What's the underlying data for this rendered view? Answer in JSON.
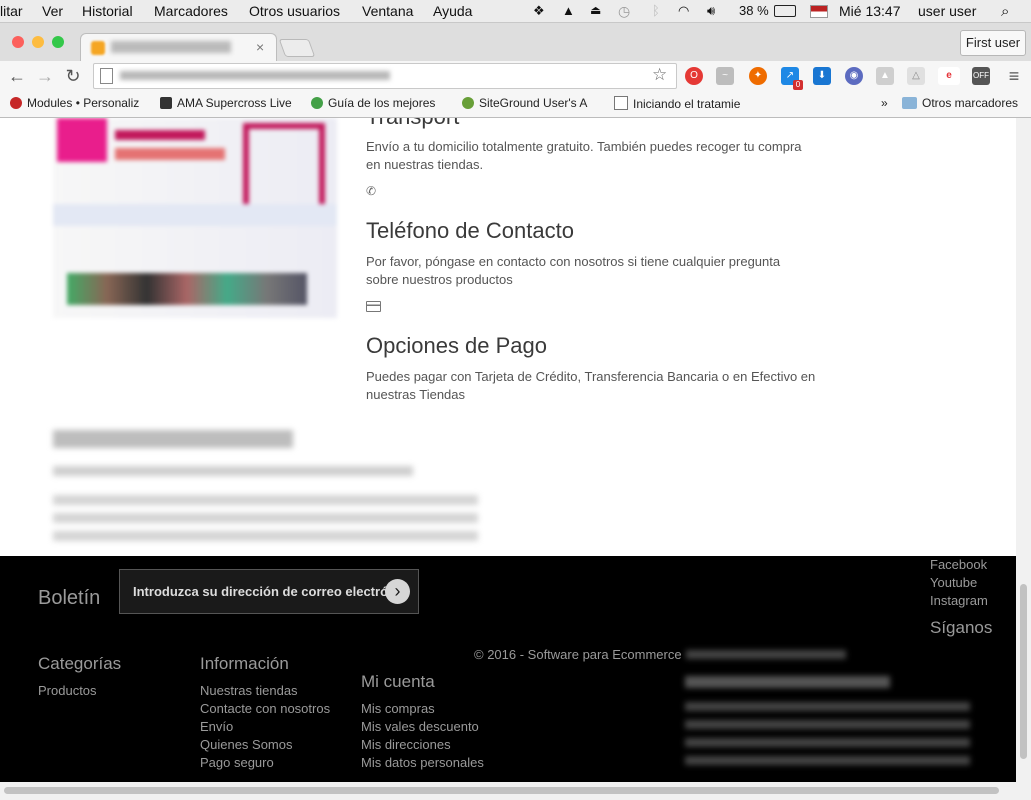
{
  "menubar": {
    "items": [
      "litar",
      "Ver",
      "Historial",
      "Marcadores",
      "Otros usuarios",
      "Ventana",
      "Ayuda"
    ],
    "battery": "38 %",
    "clock": "Mié 13:47",
    "user": "user user"
  },
  "browser": {
    "profile_button": "First user",
    "bookmarks": [
      {
        "label": "Modules • Personaliz",
        "icon": "bookmark-favicon"
      },
      {
        "label": "AMA Supercross Live",
        "icon": "bookmark-favicon"
      },
      {
        "label": "Guía de los mejores",
        "icon": "bookmark-favicon"
      },
      {
        "label": "SiteGround User's A",
        "icon": "bookmark-favicon"
      },
      {
        "label": "Iniciando el tratamie",
        "icon": "document-icon"
      }
    ],
    "bookmarks_overflow": "»",
    "other_bookmarks": "Otros marcadores",
    "extension_badge": "0"
  },
  "content": {
    "sections": [
      {
        "title": "Transport",
        "text": "Envío a tu domicilio totalmente gratuito. También puedes recoger tu compra en nuestras tiendas.",
        "icon": "phone-icon"
      },
      {
        "title": "Teléfono de Contacto",
        "text": "Por favor, póngase en contacto con nosotros si tiene cualquier pregunta sobre nuestros productos",
        "icon": "credit-card-icon"
      },
      {
        "title": "Opciones de Pago",
        "text": "Puedes pagar con Tarjeta de Crédito, Transferencia Bancaria o en Efectivo en nuestras Tiendas"
      }
    ]
  },
  "footer": {
    "newsletter_label": "Boletín",
    "newsletter_placeholder": "Introduzca su dirección de correo electrón",
    "social": {
      "links": [
        "Facebook",
        "Youtube",
        "Instagram"
      ],
      "title": "Síganos"
    },
    "copyright": "© 2016 - Software para Ecommerce",
    "categories": {
      "title": "Categorías",
      "links": [
        "Productos"
      ]
    },
    "information": {
      "title": "Información",
      "links": [
        "Nuestras tiendas",
        "Contacte con nosotros",
        "Envío",
        "Quienes Somos",
        "Pago seguro"
      ]
    },
    "account": {
      "title": "Mi cuenta",
      "links": [
        "Mis compras",
        "Mis vales descuento",
        "Mis direcciones",
        "Mis datos personales"
      ]
    }
  }
}
